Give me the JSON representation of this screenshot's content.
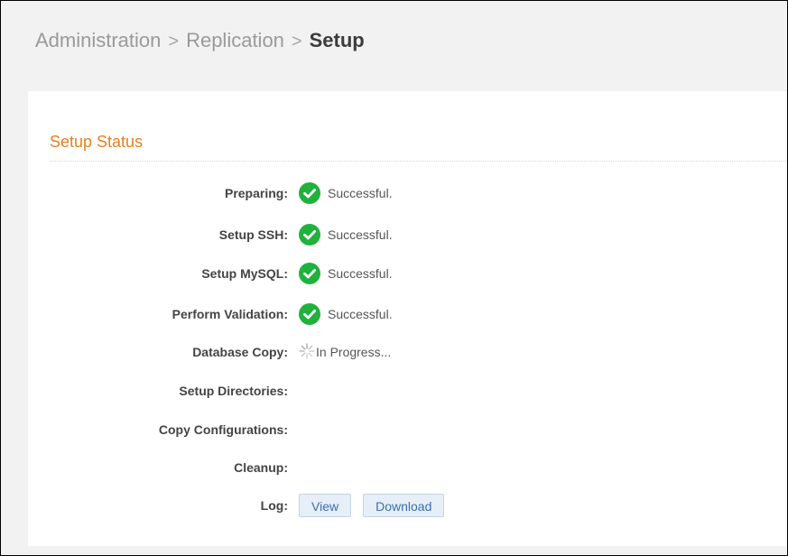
{
  "breadcrumb": {
    "items": [
      "Administration",
      "Replication"
    ],
    "separator": ">",
    "current": "Setup"
  },
  "section": {
    "title": "Setup Status"
  },
  "status_rows": [
    {
      "label": "Preparing:",
      "status": "Successful.",
      "state": "success"
    },
    {
      "label": "Setup SSH:",
      "status": "Successful.",
      "state": "success"
    },
    {
      "label": "Setup MySQL:",
      "status": "Successful.",
      "state": "success"
    },
    {
      "label": "Perform Validation:",
      "status": "Successful.",
      "state": "success"
    },
    {
      "label": "Database Copy:",
      "status": "In Progress...",
      "state": "in-progress"
    },
    {
      "label": "Setup Directories:",
      "status": "",
      "state": "pending"
    },
    {
      "label": "Copy Configurations:",
      "status": "",
      "state": "pending"
    },
    {
      "label": "Cleanup:",
      "status": "",
      "state": "pending"
    }
  ],
  "log": {
    "label": "Log:",
    "view_label": "View",
    "download_label": "Download"
  },
  "icons": {
    "success": "check-circle-icon",
    "in_progress": "spinner-icon"
  },
  "colors": {
    "section_title": "#e8801c",
    "success_green": "#1fb23c",
    "link_blue": "#3b6fb0",
    "button_bg": "#e6eef7"
  }
}
